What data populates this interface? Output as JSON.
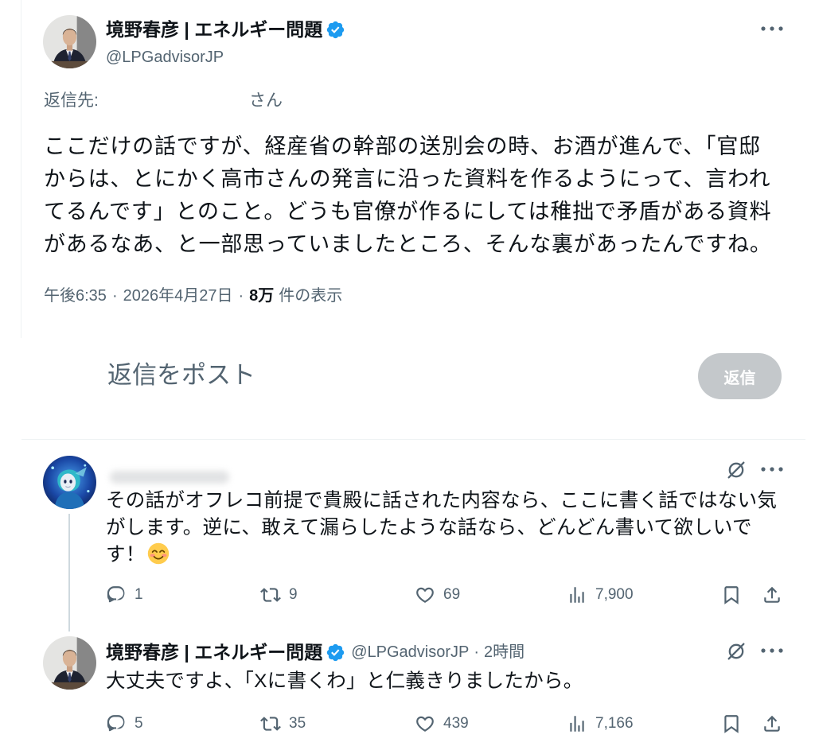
{
  "colors": {
    "text_primary": "#0f1419",
    "text_secondary": "#536471",
    "verified_blue": "#1d9bf0",
    "reply_button_disabled": "#c4c8cb",
    "divider": "#eff3f4",
    "thread_line": "#cfd9de"
  },
  "main_post": {
    "author": {
      "name": "境野春彦 | エネルギー問題",
      "handle": "@LPGadvisorJP",
      "avatar_icon": "author-avatar",
      "verified_icon": "verified-badge-icon"
    },
    "more_icon": "more-icon",
    "reply_to": {
      "label": "返信先:",
      "suffix": "さん"
    },
    "text_lines": [
      "ここだけの話ですが、経産省の幹部の送別会の時、お酒が進んで、「官邸",
      "からは、とにかく高市さんの発言に沿った資料を作るようにって、言われ",
      "てるんです」とのこと。どうも官僚が作るにしては稚拙で矛盾がある資料",
      "があるなあ、と一部思っていましたところ、そんな裏があったんですね。"
    ],
    "meta": {
      "time": "午後6:35",
      "separator": "·",
      "date": "2026年4月27日",
      "views_count": "8万",
      "views_label": "件の表示"
    }
  },
  "composer": {
    "placeholder": "返信をポスト",
    "reply_button_label": "返信"
  },
  "replies": [
    {
      "author": {
        "avatar_icon": "anime-character-avatar"
      },
      "grok_icon": "grok-explain-icon",
      "more_icon": "more-icon",
      "text_lines": [
        "その話がオフレコ前提で貴殿に話された内容なら、ここに書く話ではない気",
        "がします。逆に、敢えて漏らしたような話なら、どんどん書いて欲しいで",
        "す！"
      ],
      "trailing_emoji_icon": "smiling-face-with-smiling-eyes-emoji",
      "stats": {
        "replies": "1",
        "reposts": "9",
        "likes": "69",
        "views": "7,900"
      }
    },
    {
      "author": {
        "name": "境野春彦 | エネルギー問題",
        "handle": "@LPGadvisorJP",
        "avatar_icon": "author-avatar",
        "verified_icon": "verified-badge-icon"
      },
      "separator": "·",
      "time": "2時間",
      "grok_icon": "grok-explain-icon",
      "more_icon": "more-icon",
      "text_lines": [
        "大丈夫ですよ、「Xに書くわ」と仁義きりましたから。"
      ],
      "stats": {
        "replies": "5",
        "reposts": "35",
        "likes": "439",
        "views": "7,166"
      }
    }
  ],
  "action_icons": {
    "reply": "reply-icon",
    "repost": "repost-icon",
    "like": "like-icon",
    "views": "views-icon",
    "bookmark": "bookmark-icon",
    "share": "share-icon"
  }
}
